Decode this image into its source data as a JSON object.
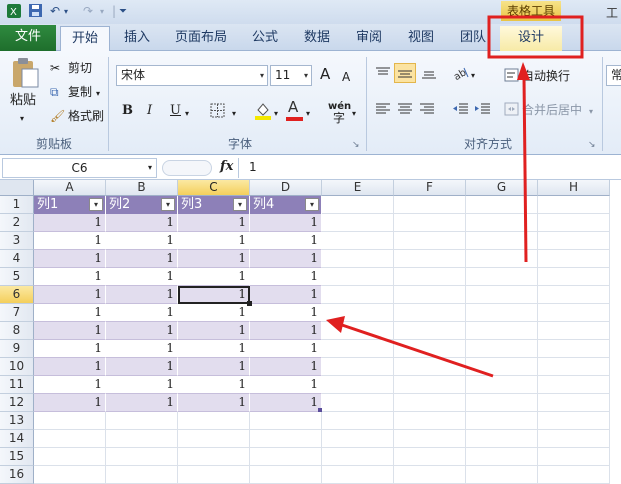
{
  "qat": {
    "undo_label": "↶",
    "redo_label": "↷",
    "more_label": "⏷"
  },
  "window": {
    "context_tab_group": "表格工具",
    "title_fragment": "工"
  },
  "tabs": [
    {
      "label": "文件"
    },
    {
      "label": "开始"
    },
    {
      "label": "插入"
    },
    {
      "label": "页面布局"
    },
    {
      "label": "公式"
    },
    {
      "label": "数据"
    },
    {
      "label": "审阅"
    },
    {
      "label": "视图"
    },
    {
      "label": "团队"
    },
    {
      "label": "设计"
    }
  ],
  "ribbon": {
    "clipboard": {
      "paste": "粘贴",
      "cut": "剪切",
      "copy": "复制",
      "format_painter": "格式刷",
      "label": "剪贴板"
    },
    "font": {
      "name": "宋体",
      "size": "11",
      "grow": "A",
      "shrink": "A",
      "bold": "B",
      "italic": "I",
      "underline": "U",
      "font_color_letter": "A",
      "phonetic": "wén",
      "label": "字体"
    },
    "alignment": {
      "wrap_text": "自动换行",
      "merge_center": "合并后居中",
      "label": "对齐方式"
    },
    "number_fragment": "常"
  },
  "formula_bar": {
    "name_box": "C6",
    "fx_label": "fx",
    "value": "1"
  },
  "sheet": {
    "columns": [
      "A",
      "B",
      "C",
      "D",
      "E",
      "F",
      "G",
      "H"
    ],
    "rows": [
      "1",
      "2",
      "3",
      "4",
      "5",
      "6",
      "7",
      "8",
      "9",
      "10",
      "11",
      "12",
      "13",
      "14",
      "15",
      "16"
    ],
    "table_headers": [
      "列1",
      "列2",
      "列3",
      "列4"
    ],
    "filter_glyph": "▾",
    "table_rows": [
      [
        "1",
        "1",
        "1",
        "1"
      ],
      [
        "1",
        "1",
        "1",
        "1"
      ],
      [
        "1",
        "1",
        "1",
        "1"
      ],
      [
        "1",
        "1",
        "1",
        "1"
      ],
      [
        "1",
        "1",
        "1",
        "1"
      ],
      [
        "1",
        "1",
        "1",
        "1"
      ],
      [
        "1",
        "1",
        "1",
        "1"
      ],
      [
        "1",
        "1",
        "1",
        "1"
      ],
      [
        "1",
        "1",
        "1",
        "1"
      ],
      [
        "1",
        "1",
        "1",
        "1"
      ],
      [
        "1",
        "1",
        "1",
        "1"
      ]
    ],
    "selected_cell": "C6"
  },
  "colors": {
    "file_tab": "#2f8a3f",
    "table_header": "#8d80b8",
    "band": "#e2ddee",
    "annotation": "#e02020",
    "context_tab": "#e9c443"
  }
}
